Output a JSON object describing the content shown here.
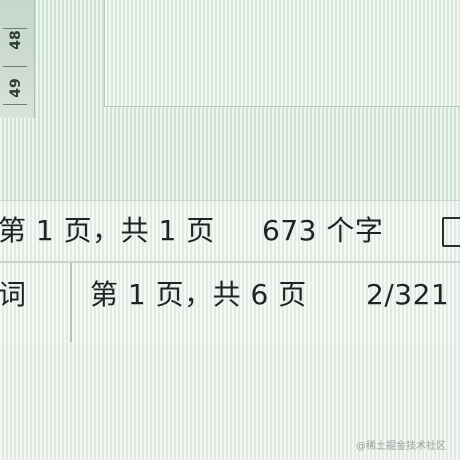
{
  "ruler": {
    "labels": [
      "49",
      "48"
    ]
  },
  "status_bar_1": {
    "page_info": "第 1 页，共 1 页",
    "word_count": "673 个字"
  },
  "status_bar_2": {
    "left_text": "词",
    "page_info": "第 1 页，共 6 页",
    "ratio": "2/321"
  },
  "watermark": "@稀土掘金技术社区",
  "colors": {
    "screen_tint": "#cfe3d6",
    "text": "#1f2422"
  }
}
